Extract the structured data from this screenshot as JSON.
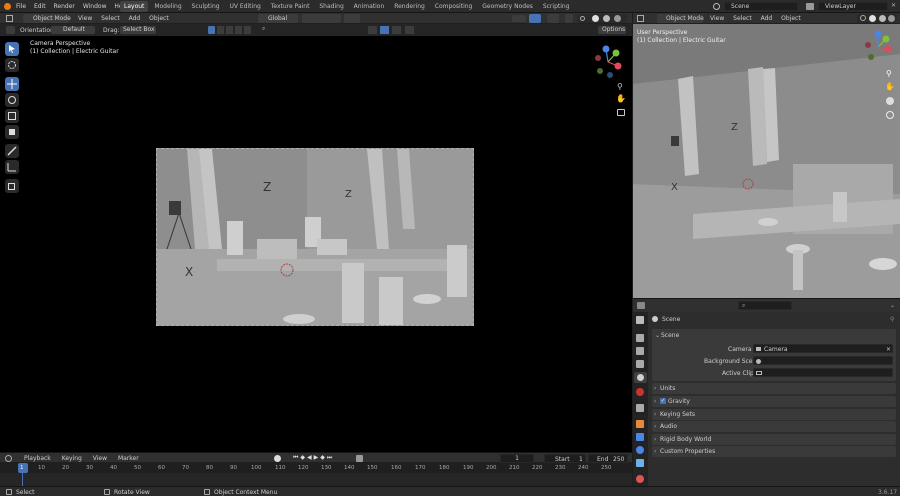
{
  "menu": [
    "File",
    "Edit",
    "Render",
    "Window",
    "Help"
  ],
  "workspaces": [
    "Layout",
    "Modeling",
    "Sculpting",
    "UV Editing",
    "Texture Paint",
    "Shading",
    "Animation",
    "Rendering",
    "Compositing",
    "Geometry Nodes",
    "Scripting"
  ],
  "active_workspace": "Layout",
  "scene_name": "Scene",
  "view_layer": "ViewLayer",
  "left_view": {
    "mode": "Object Mode",
    "menus": [
      "View",
      "Select",
      "Add",
      "Object"
    ],
    "transform_orientation": "Global",
    "orientation_label": "Orientation:",
    "orientation_value": "Default",
    "drag_label": "Drag:",
    "drag_value": "Select Box",
    "options_label": "Options",
    "perspective_label": "Camera Perspective",
    "collection_label": "(1) Collection | Electric Guitar"
  },
  "right_view": {
    "mode": "Object Mode",
    "menus": [
      "View",
      "Select",
      "Add",
      "Object"
    ],
    "perspective_label": "User Perspective",
    "collection_label": "(1) Collection | Electric Guitar"
  },
  "axis_letters": {
    "x": "X",
    "y": "Y",
    "z": "Z"
  },
  "properties": {
    "context_label": "Scene",
    "panel_title": "Scene",
    "camera_label": "Camera",
    "camera_value": "Camera",
    "background_label": "Background Scene",
    "active_clip_label": "Active Clip",
    "collapsed_panels": [
      "Units",
      "Gravity",
      "Keying Sets",
      "Audio",
      "Rigid Body World",
      "Custom Properties"
    ],
    "gravity_checked": true
  },
  "timeline": {
    "menus": [
      "Playback",
      "Keying",
      "View",
      "Marker"
    ],
    "current_frame": "1",
    "start_label": "Start",
    "start_value": "1",
    "end_label": "End",
    "end_value": "250",
    "ticks": [
      "1",
      "10",
      "20",
      "30",
      "40",
      "50",
      "60",
      "70",
      "80",
      "90",
      "100",
      "110",
      "120",
      "130",
      "140",
      "150",
      "160",
      "170",
      "180",
      "190",
      "200",
      "210",
      "220",
      "230",
      "240",
      "250"
    ]
  },
  "statusbar": {
    "select": "Select",
    "rotate": "Rotate View",
    "context_menu": "Object Context Menu",
    "version": "3.6.17"
  },
  "colors": {
    "accent": "#4772b3",
    "viewport_bg": "#000000",
    "scene_gray": "#8a8a8a",
    "axis_x": "#e04b5b",
    "axis_y": "#7ec140",
    "axis_z": "#4a86e8"
  }
}
